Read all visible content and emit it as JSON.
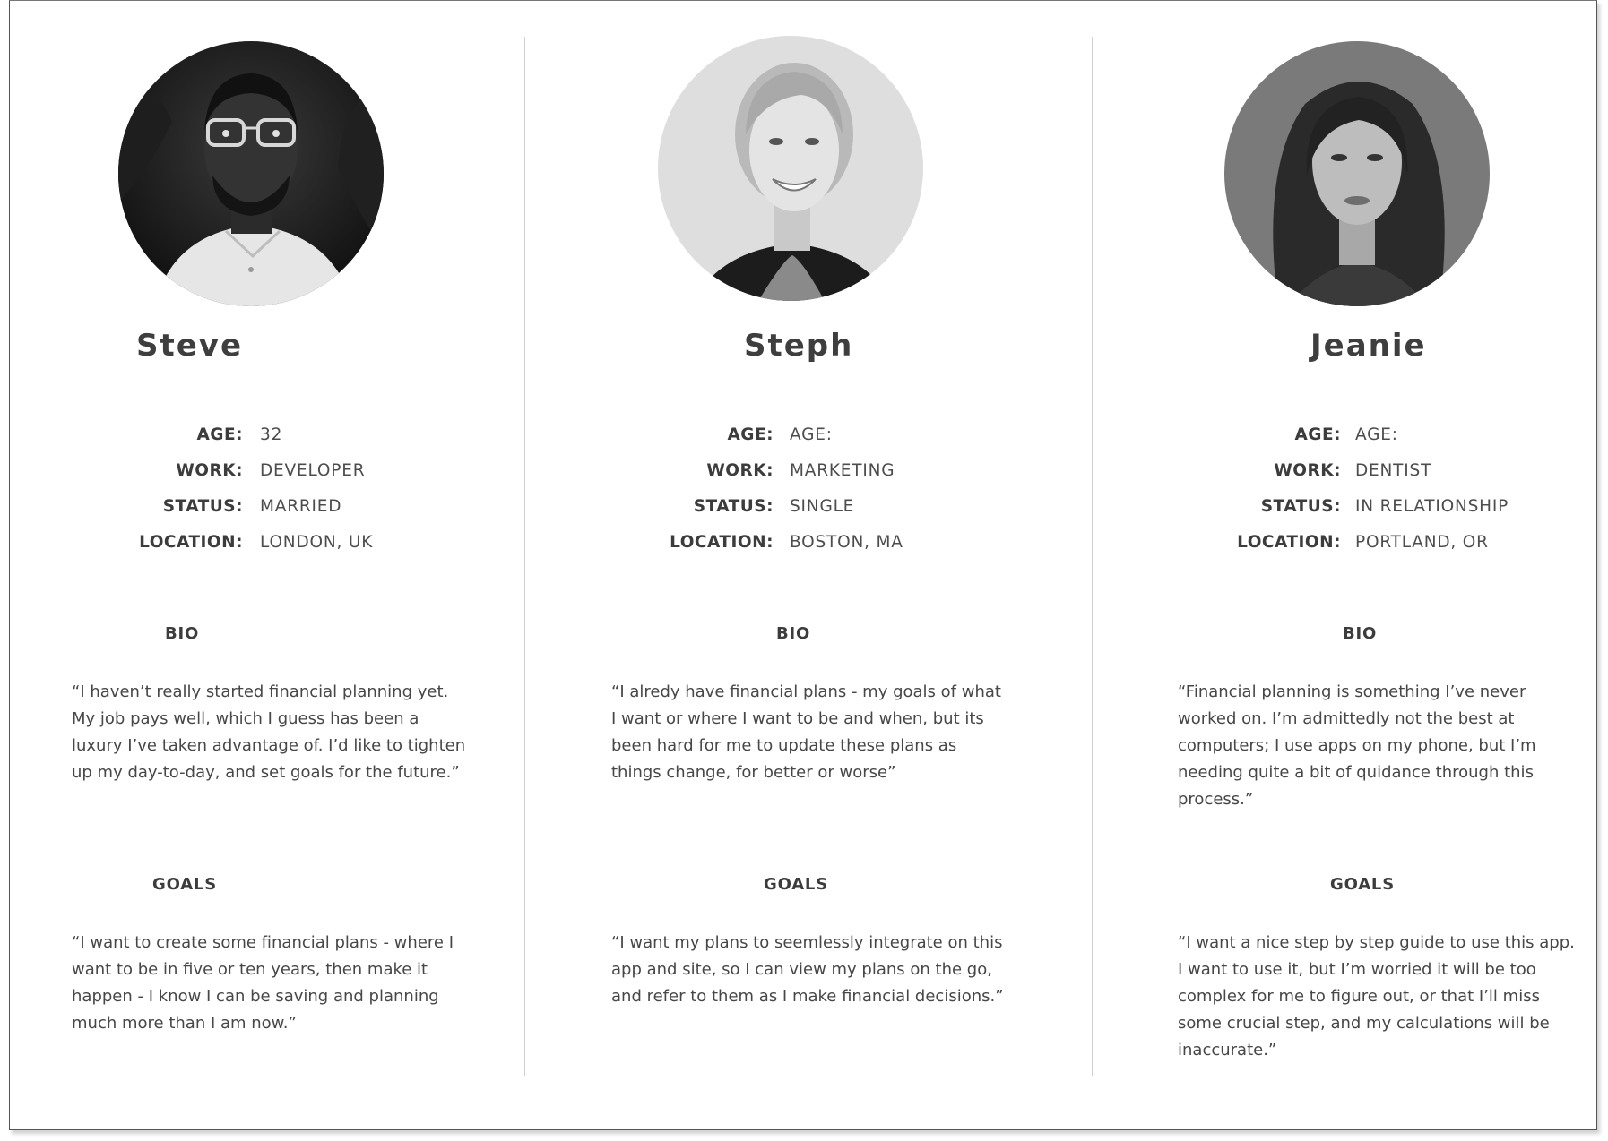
{
  "personas": [
    {
      "name": "Steve",
      "age_label": "AGE:",
      "age": "32",
      "work_label": "WORK:",
      "work": "DEVELOPER",
      "status_label": "STATUS:",
      "status": "MARRIED",
      "location_label": "LOCATION:",
      "location": "LONDON, UK",
      "bio_heading": "BIO",
      "bio_lines": [
        "“I haven’t really started financial planning yet.",
        "My job pays well, which I guess has been a",
        "luxury I’ve taken advantage of. I’d like to tighten",
        "up my day-to-day, and set goals for the future.”"
      ],
      "goals_heading": "GOALS",
      "goals_lines": [
        "“I want to create some financial plans - where I",
        "want to be in five or ten years, then make it",
        "happen - I know I can be saving and planning",
        "much more than I am now.”"
      ]
    },
    {
      "name": "Steph",
      "age_label": "AGE:",
      "age": "AGE:",
      "work_label": "WORK:",
      "work": "MARKETING",
      "status_label": "STATUS:",
      "status": "SINGLE",
      "location_label": "LOCATION:",
      "location": "BOSTON, MA",
      "bio_heading": "BIO",
      "bio_lines": [
        "“I alredy have financial plans - my goals of what",
        "I want or where I want to be and when, but its",
        "been hard for me to update these plans as",
        "things change, for better or worse”"
      ],
      "goals_heading": "GOALS",
      "goals_lines": [
        "“I want my plans to seemlessly integrate on this",
        "app and site, so I can view my plans on the go,",
        "and refer to them as I make financial decisions.”"
      ]
    },
    {
      "name": "Jeanie",
      "age_label": "AGE:",
      "age": "AGE:",
      "work_label": "WORK:",
      "work": "DENTIST",
      "status_label": "STATUS:",
      "status": "IN RELATIONSHIP",
      "location_label": "LOCATION:",
      "location": "PORTLAND, OR",
      "bio_heading": "BIO",
      "bio_lines": [
        "“Financial planning is something I’ve never",
        "worked on. I’m admittedly not the best at",
        "computers; I use apps on my phone, but I’m",
        "needing quite a bit of quidance through this",
        "process.”"
      ],
      "goals_heading": "GOALS",
      "goals_lines": [
        "“I want a nice step by step guide to use this app.",
        "I want to use it, but I’m worried it will be too",
        "complex for me to figure out, or that I’ll miss",
        "some crucial step, and my calculations will be",
        "inaccurate.”"
      ]
    }
  ]
}
